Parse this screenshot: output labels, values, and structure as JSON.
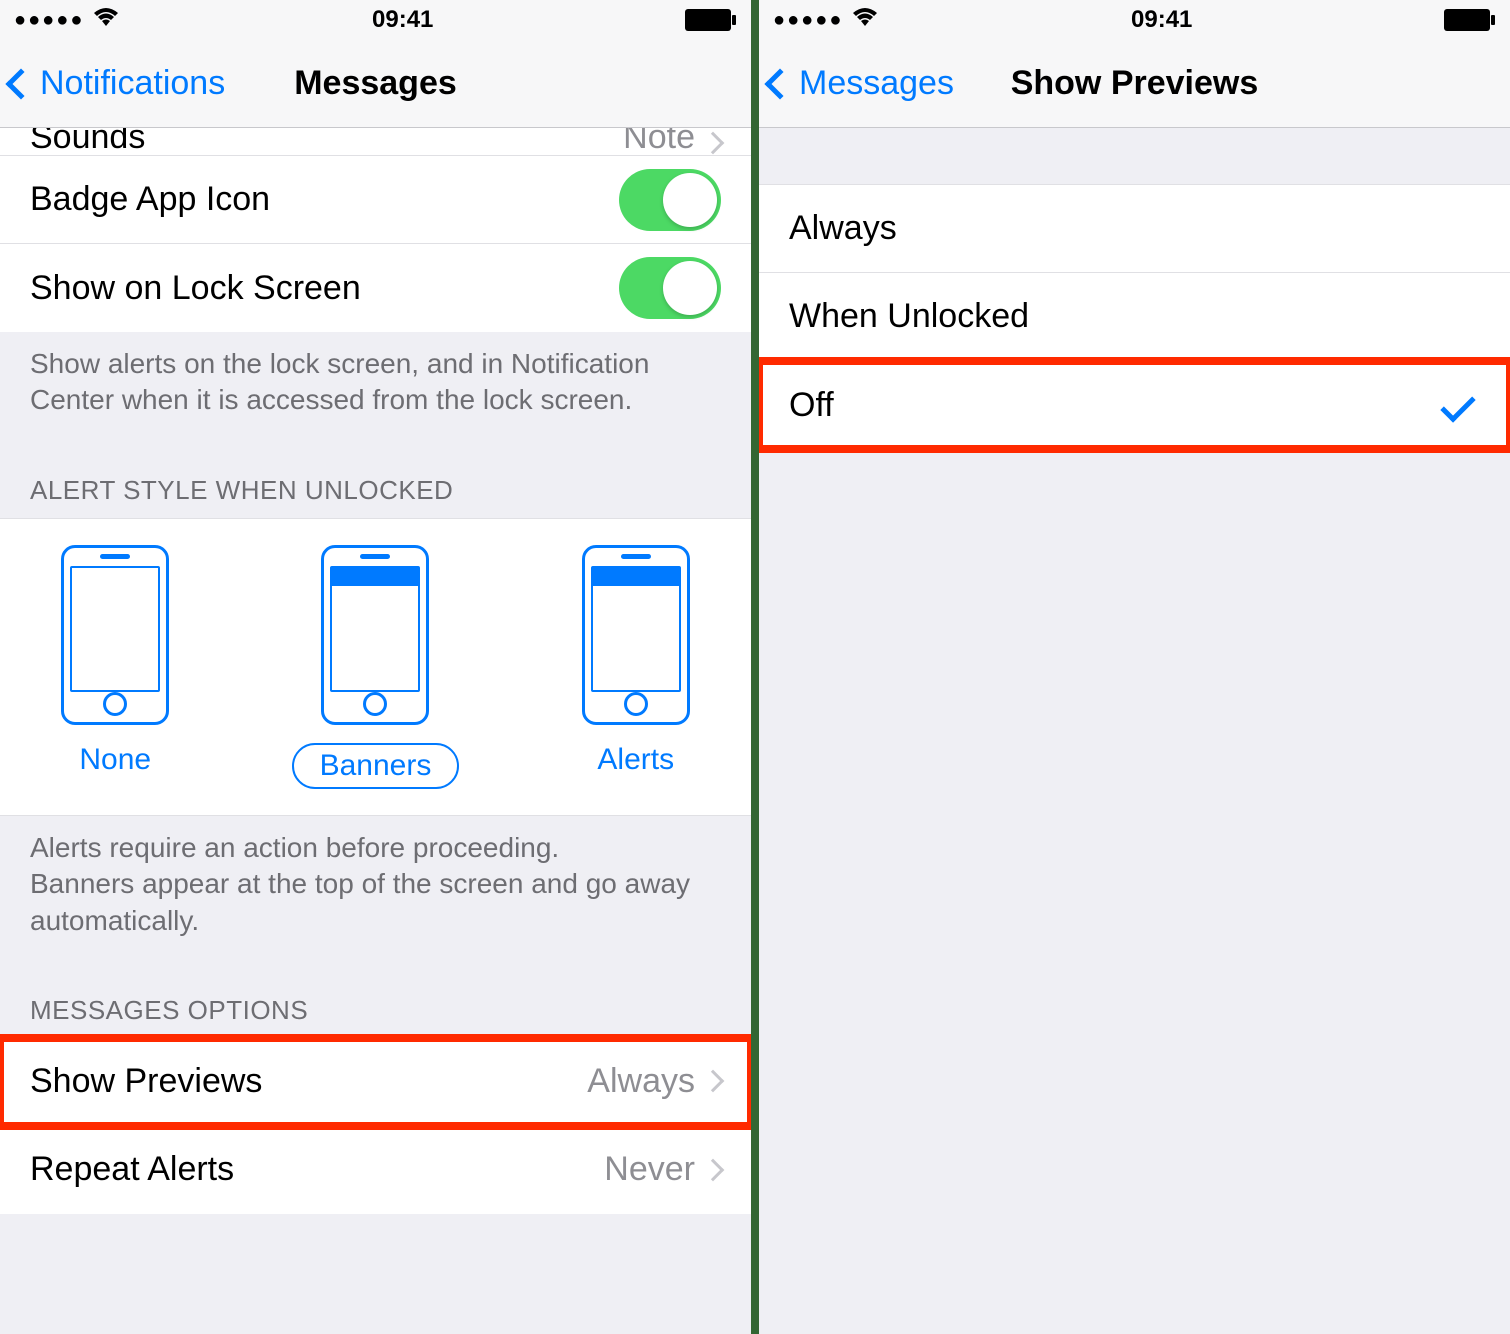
{
  "status": {
    "time": "09:41"
  },
  "left": {
    "back_label": "Notifications",
    "title": "Messages",
    "rows": {
      "sounds_label": "Sounds",
      "sounds_value": "Note",
      "badge_label": "Badge App Icon",
      "lock_label": "Show on Lock Screen"
    },
    "lock_footer": "Show alerts on the lock screen, and in Notification Center when it is accessed from the lock screen.",
    "alert_header": "ALERT STYLE WHEN UNLOCKED",
    "alert_styles": {
      "none": "None",
      "banners": "Banners",
      "alerts": "Alerts"
    },
    "alert_footer": "Alerts require an action before proceeding.\nBanners appear at the top of the screen and go away automatically.",
    "options_header": "MESSAGES OPTIONS",
    "previews_label": "Show Previews",
    "previews_value": "Always",
    "repeat_label": "Repeat Alerts",
    "repeat_value": "Never"
  },
  "right": {
    "back_label": "Messages",
    "title": "Show Previews",
    "options": {
      "always": "Always",
      "unlocked": "When Unlocked",
      "off": "Off"
    }
  }
}
